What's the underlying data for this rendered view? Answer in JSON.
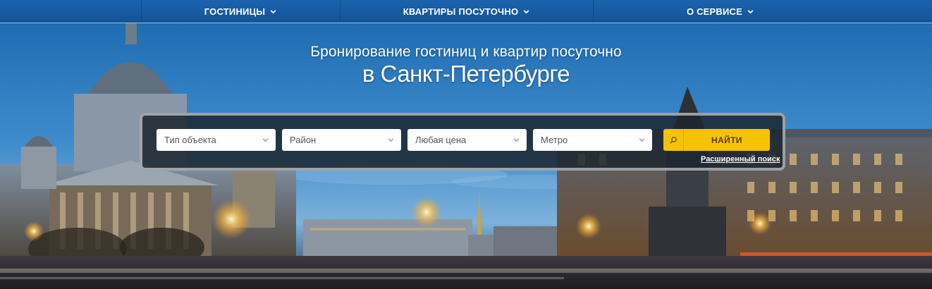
{
  "nav": {
    "items": [
      {
        "label": "ГОСТИНИЦЫ"
      },
      {
        "label": "КВАРТИРЫ ПОСУТОЧНО"
      },
      {
        "label": "О СЕРВИСЕ"
      }
    ]
  },
  "hero": {
    "subtitle": "Бронирование гостиниц и квартир посуточно",
    "title": "в Санкт-Петербурге"
  },
  "search": {
    "type_select": "Тип объекта",
    "district_select": "Район",
    "price_select": "Любая цена",
    "metro_select": "Метро",
    "find_button": "НАЙТИ",
    "advanced_link": "Расширенный поиск"
  },
  "colors": {
    "nav_bg": "#1b62ad",
    "accent_yellow": "#f5c400",
    "panel_bg": "#1c2630"
  },
  "icons": [
    "chevron-down-icon",
    "search-icon"
  ]
}
